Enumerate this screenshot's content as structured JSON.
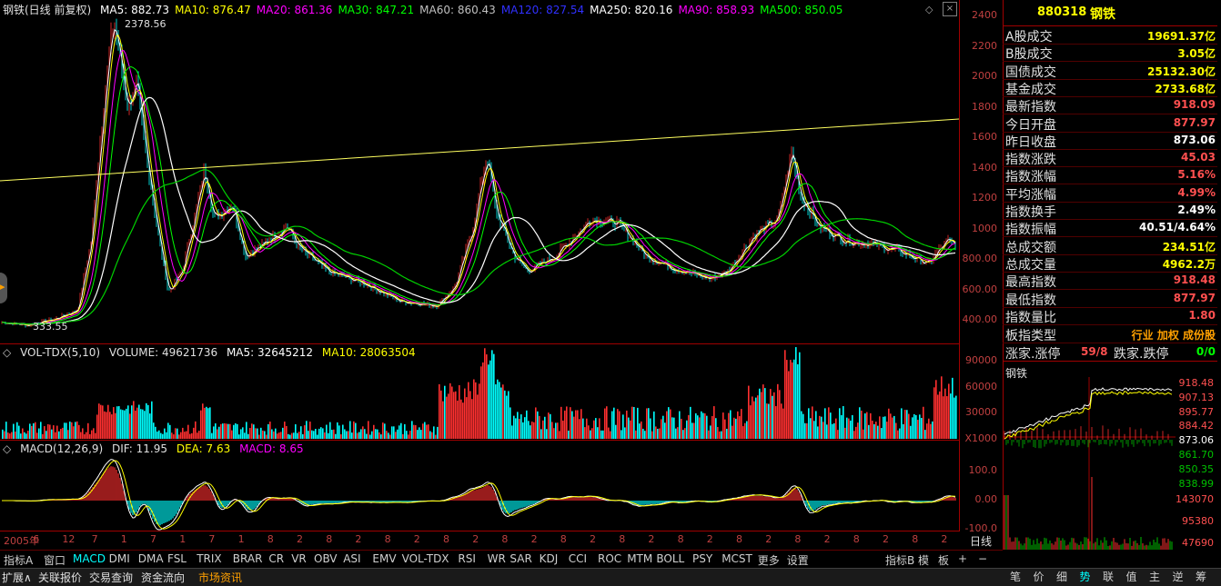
{
  "main_header": {
    "title": "钢铁(日线 前复权)",
    "ma": [
      {
        "label": "MA5: 882.73",
        "color": "#ffffff"
      },
      {
        "label": "MA10: 876.47",
        "color": "#ffff00"
      },
      {
        "label": "MA20: 861.36",
        "color": "#ff00ff"
      },
      {
        "label": "MA30: 847.21",
        "color": "#00ff00"
      },
      {
        "label": "MA60: 860.43",
        "color": "#c0c0c0"
      },
      {
        "label": "MA120: 827.54",
        "color": "#3030ff"
      },
      {
        "label": "MA250: 820.16",
        "color": "#ffffff"
      },
      {
        "label": "MA90: 858.93",
        "color": "#ff00ff"
      },
      {
        "label": "MA500: 850.05",
        "color": "#00ff00"
      }
    ],
    "high_label": "2378.56",
    "low_label": "333.55"
  },
  "price_axis": [
    "2400",
    "2200",
    "2000",
    "1800",
    "1600",
    "1400",
    "1200",
    "1000",
    "800.00",
    "600.00",
    "400.00"
  ],
  "vol_header": {
    "name": "VOL-TDX(5,10)",
    "volume": "VOLUME: 49621736",
    "ma5": "MA5: 32645212",
    "ma10": "MA10: 28063504"
  },
  "vol_axis": [
    "90000",
    "60000",
    "30000",
    "X1000"
  ],
  "macd_header": {
    "name": "MACD(12,26,9)",
    "dif": "DIF: 11.95",
    "dea": "DEA: 7.63",
    "macd": "MACD: 8.65"
  },
  "macd_axis": [
    "100.0",
    "0.00",
    "-100.0"
  ],
  "time_axis": [
    "2005年",
    "6",
    "12",
    "7",
    "1",
    "7",
    "1",
    "7",
    "1",
    "8",
    "2",
    "8",
    "2",
    "8",
    "2",
    "8",
    "2",
    "8",
    "2",
    "8",
    "2",
    "8",
    "2",
    "8",
    "2",
    "8",
    "2",
    "8",
    "2",
    "8",
    "2",
    "8",
    "2"
  ],
  "right_panel": {
    "code": "880318",
    "name": "钢铁",
    "rows": [
      {
        "label": "A股成交",
        "value": "19691.37亿",
        "color": "#ffff00"
      },
      {
        "label": "B股成交",
        "value": "3.05亿",
        "color": "#ffff00"
      },
      {
        "label": "国债成交",
        "value": "25132.30亿",
        "color": "#ffff00"
      },
      {
        "label": "基金成交",
        "value": "2733.68亿",
        "color": "#ffff00"
      },
      {
        "label": "最新指数",
        "value": "918.09",
        "color": "#ff5050"
      },
      {
        "label": "今日开盘",
        "value": "877.97",
        "color": "#ff5050"
      },
      {
        "label": "昨日收盘",
        "value": "873.06",
        "color": "#ffffff"
      },
      {
        "label": "指数涨跌",
        "value": "45.03",
        "color": "#ff5050"
      },
      {
        "label": "指数涨幅",
        "value": "5.16%",
        "color": "#ff5050"
      },
      {
        "label": "平均涨幅",
        "value": "4.99%",
        "color": "#ff5050"
      },
      {
        "label": "指数换手",
        "value": "2.49%",
        "color": "#ffffff"
      },
      {
        "label": "指数振幅",
        "value": "40.51/4.64%",
        "color": "#ffffff"
      },
      {
        "label": "总成交额",
        "value": "234.51亿",
        "color": "#ffff00"
      },
      {
        "label": "总成交量",
        "value": "4962.2万",
        "color": "#ffff00"
      },
      {
        "label": "最高指数",
        "value": "918.48",
        "color": "#ff5050"
      },
      {
        "label": "最低指数",
        "value": "877.97",
        "color": "#ff5050"
      },
      {
        "label": "指数量比",
        "value": "1.80",
        "color": "#ff5050"
      }
    ],
    "board_type_label": "板指类型",
    "board_type_value": "行业 加权 成份股",
    "up_limit_label": "涨家.涨停",
    "up_limit_value": "59/8",
    "down_limit_label": "跌家.跌停",
    "down_limit_value": "0/0",
    "mini_title": "钢铁",
    "mini_price_axis": [
      "918.48",
      "907.13",
      "895.77",
      "884.42",
      "873.06",
      "861.70",
      "850.35",
      "838.99"
    ],
    "mini_vol_axis": [
      "143070",
      "95380",
      "47690"
    ]
  },
  "tabs": [
    "指标A",
    "窗口",
    "MACD",
    "DMI",
    "DMA",
    "FSL",
    "TRIX",
    "BRAR",
    "CR",
    "VR",
    "OBV",
    "ASI",
    "EMV",
    "VOL-TDX",
    "RSI",
    "WR",
    "SAR",
    "KDJ",
    "CCI",
    "ROC",
    "MTM",
    "BOLL",
    "PSY",
    "MCST",
    "更多",
    "设置"
  ],
  "active_tab": "MACD",
  "tabs_right": [
    "指标B",
    "模",
    "板",
    "+",
    "−"
  ],
  "period_label": "日线",
  "status": [
    "扩展∧",
    "关联报价",
    "交易查询",
    "资金流向",
    "市场资讯"
  ],
  "right_tabs": [
    "笔",
    "价",
    "细",
    "势",
    "联",
    "值",
    "主",
    "逆",
    "筹"
  ],
  "right_tabs_active": "势"
}
